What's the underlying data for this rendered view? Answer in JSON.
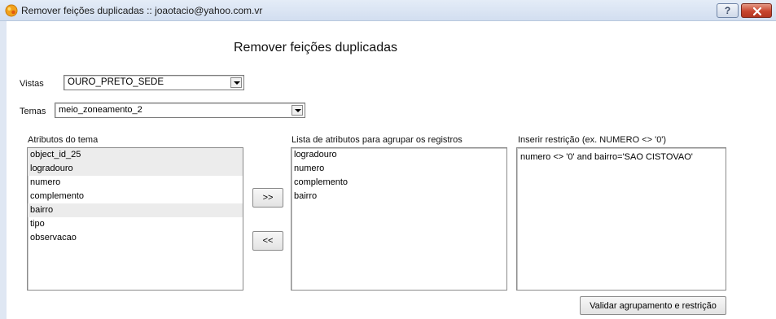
{
  "window": {
    "title": "Remover feições duplicadas :: joaotacio@yahoo.com.vr",
    "help_label": "?"
  },
  "heading": "Remover feições duplicadas",
  "vistas": {
    "label": "Vistas",
    "selected": "OURO_PRETO_SEDE"
  },
  "temas": {
    "label": "Temas",
    "selected": "meio_zoneamento_2"
  },
  "theme_attributes": {
    "label": "Atributos do tema",
    "items": [
      "object_id_25",
      "logradouro",
      "numero",
      "complemento",
      "bairro",
      "tipo",
      "observacao"
    ]
  },
  "buttons": {
    "add_label": ">>",
    "remove_label": "<<",
    "validate_label": "Validar agrupamento e restrição"
  },
  "group_attributes": {
    "label": "Lista de atributos para agrupar os registros",
    "items": [
      "logradouro",
      "numero",
      "complemento",
      "bairro"
    ]
  },
  "restriction": {
    "label": "Inserir restrição (ex. NUMERO <> '0')",
    "value": "numero <> '0' and bairro='SAO CISTOVAO'"
  }
}
